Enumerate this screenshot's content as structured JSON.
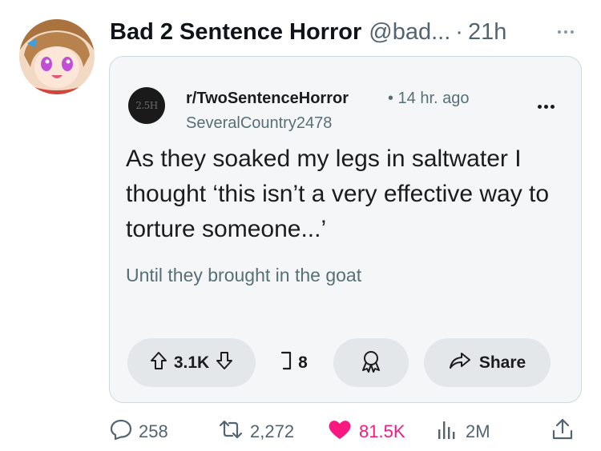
{
  "tweet": {
    "author_name": "Bad 2 Sentence Horror",
    "author_handle": "@bad...",
    "separator": "·",
    "time": "21h"
  },
  "card": {
    "subreddit": "r/TwoSentenceHorror",
    "meta": "• 14 hr. ago",
    "post_author": "SeveralCountry2478",
    "sub_icon_text": "2.5H",
    "title": "As they soaked my legs in saltwater I thought ‘this isn’t a very effective way to torture someone...’",
    "body": "Until they brought in the goat",
    "votes": "3.1K",
    "comments": "8",
    "share_label": "Share"
  },
  "actions": {
    "replies": "258",
    "retweets": "2,272",
    "likes": "81.5K",
    "views": "2M"
  },
  "colors": {
    "like": "#f91880",
    "muted": "#536471",
    "card_bg": "#f5f6f7",
    "pill_bg": "#e3e7e9"
  },
  "icons": [
    "more-icon",
    "upvote-icon",
    "downvote-icon",
    "comment-icon",
    "award-icon",
    "share-arrow-icon",
    "reply-icon",
    "retweet-icon",
    "heart-icon",
    "views-icon",
    "share-icon"
  ]
}
